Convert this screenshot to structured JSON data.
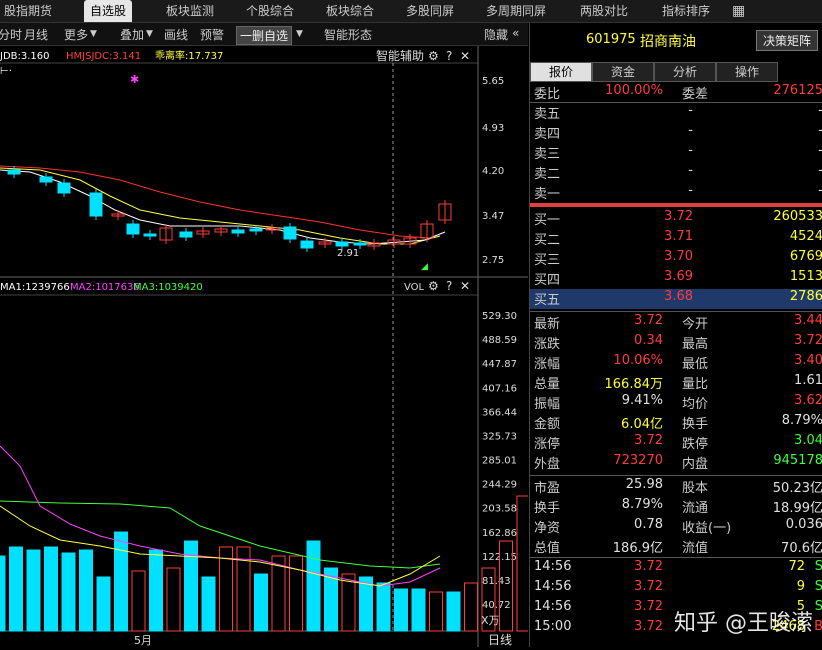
{
  "topbar": {
    "tabs": [
      {
        "label": "股指期货",
        "active": false
      },
      {
        "label": "自选股",
        "active": true
      },
      {
        "label": "板块监测",
        "active": false
      },
      {
        "label": "个股综合",
        "active": false
      },
      {
        "label": "板块综合",
        "active": false
      },
      {
        "label": "多股同屏",
        "active": false
      },
      {
        "label": "多周期同屏",
        "active": false
      },
      {
        "label": "两股对比",
        "active": false
      },
      {
        "label": "指标排序",
        "active": false
      }
    ]
  },
  "toolbar": {
    "items": [
      "分时",
      "月线",
      "更多",
      "叠加",
      "画线",
      "预警",
      "一删自选",
      "智能形态"
    ],
    "hide_label": "隐藏",
    "hide_chevron": "«"
  },
  "kline_panel": {
    "indicators": [
      {
        "text": "JDB:3.160",
        "color": "#ffffff"
      },
      {
        "text": "HMJSJDC:3.141",
        "color": "#ff4040"
      },
      {
        "text": "乖离率:17.737",
        "color": "#ffff40"
      }
    ],
    "assist_label": "智能辅助",
    "y_labels": [
      "5.65",
      "4.93",
      "4.20",
      "3.47",
      "2.75"
    ],
    "low_marker": "2.91"
  },
  "volume_panel": {
    "indicators": [
      {
        "text": "MA1:1239766",
        "color": "#ffffff"
      },
      {
        "text": "MA2:1017636",
        "color": "#ff40ff"
      },
      {
        "text": "MA3:1039420",
        "color": "#40ff40"
      }
    ],
    "vol_label": "VOL",
    "y_labels": [
      "529.30",
      "488.59",
      "447.87",
      "407.16",
      "366.44",
      "325.73",
      "285.01",
      "244.29",
      "203.58",
      "162.86",
      "122.15",
      "81.43",
      "40.72"
    ],
    "unit": "X万",
    "x_label": "5月",
    "period": "日线",
    "volumes": [
      0.25,
      0.28,
      0.27,
      0.28,
      0.26,
      0.27,
      0.18,
      0.33,
      0.2,
      0.27,
      0.21,
      0.3,
      0.18,
      0.28,
      0.28,
      0.19,
      0.25,
      0.25,
      0.3,
      0.21,
      0.19,
      0.18,
      0.16,
      0.14,
      0.14,
      0.13,
      0.13,
      0.16,
      0.21,
      0.3,
      0.45,
      0.38
    ],
    "vol_colors": [
      "c",
      "c",
      "c",
      "c",
      "c",
      "c",
      "c",
      "c",
      "r",
      "c",
      "r",
      "c",
      "c",
      "r",
      "r",
      "c",
      "r",
      "r",
      "c",
      "c",
      "r",
      "c",
      "c",
      "c",
      "c",
      "r",
      "c",
      "r",
      "r",
      "r",
      "r",
      "r"
    ]
  },
  "stock": {
    "code": "601975",
    "name": "招商南油",
    "decision_button": "决策矩阵"
  },
  "panel_tabs": [
    {
      "label": "报价",
      "active": true
    },
    {
      "label": "资金",
      "active": false
    },
    {
      "label": "分析",
      "active": false
    },
    {
      "label": "操作",
      "active": false
    }
  ],
  "weibi": {
    "label": "委比",
    "value": "100.00%",
    "label2": "委差",
    "value2": "276125"
  },
  "asks": [
    {
      "label": "卖五",
      "price": "-",
      "vol": "-"
    },
    {
      "label": "卖四",
      "price": "-",
      "vol": "-"
    },
    {
      "label": "卖三",
      "price": "-",
      "vol": "-"
    },
    {
      "label": "卖二",
      "price": "-",
      "vol": "-"
    },
    {
      "label": "卖一",
      "price": "-",
      "vol": "-"
    }
  ],
  "bids": [
    {
      "label": "买一",
      "price": "3.72",
      "vol": "260533"
    },
    {
      "label": "买二",
      "price": "3.71",
      "vol": "4524"
    },
    {
      "label": "买三",
      "price": "3.70",
      "vol": "6769"
    },
    {
      "label": "买四",
      "price": "3.69",
      "vol": "1513"
    },
    {
      "label": "买五",
      "price": "3.68",
      "vol": "2786"
    }
  ],
  "stats": [
    {
      "l1": "最新",
      "v1": "3.72",
      "c1": "red",
      "l2": "今开",
      "v2": "3.44",
      "c2": "red"
    },
    {
      "l1": "涨跌",
      "v1": "0.34",
      "c1": "red",
      "l2": "最高",
      "v2": "3.72",
      "c2": "red"
    },
    {
      "l1": "涨幅",
      "v1": "10.06%",
      "c1": "red",
      "l2": "最低",
      "v2": "3.40",
      "c2": "red"
    },
    {
      "l1": "总量",
      "v1": "166.84万",
      "c1": "yellow",
      "l2": "量比",
      "v2": "1.61",
      "c2": "white"
    },
    {
      "l1": "振幅",
      "v1": "9.41%",
      "c1": "white",
      "l2": "均价",
      "v2": "3.62",
      "c2": "red"
    },
    {
      "l1": "金额",
      "v1": "6.04亿",
      "c1": "yellow",
      "l2": "换手",
      "v2": "8.79%",
      "c2": "white"
    },
    {
      "l1": "涨停",
      "v1": "3.72",
      "c1": "red",
      "l2": "跌停",
      "v2": "3.04",
      "c2": "green"
    },
    {
      "l1": "外盘",
      "v1": "723270",
      "c1": "red",
      "l2": "内盘",
      "v2": "945178",
      "c2": "green"
    }
  ],
  "fundamentals": [
    {
      "l1": "市盈",
      "v1": "25.98",
      "l2": "股本",
      "v2": "50.23亿"
    },
    {
      "l1": "换手",
      "v1": "8.79%",
      "l2": "流通",
      "v2": "18.99亿"
    },
    {
      "l1": "净资",
      "v1": "0.78",
      "l2": "收益(一)",
      "v2": "0.036"
    },
    {
      "l1": "总值",
      "v1": "186.9亿",
      "l2": "流值",
      "v2": "70.6亿"
    }
  ],
  "ticks": [
    {
      "time": "14:56",
      "price": "3.72",
      "vol": "72",
      "side": "S"
    },
    {
      "time": "14:56",
      "price": "3.72",
      "vol": "9",
      "side": "S"
    },
    {
      "time": "14:56",
      "price": "3.72",
      "vol": "5",
      "side": "S"
    },
    {
      "time": "15:00",
      "price": "3.72",
      "vol": "2468",
      "side": "B"
    }
  ],
  "watermark": "知乎 @王晙潆",
  "colors": {
    "up": "#ff3c3c",
    "down": "#00e0ff",
    "ma1": "#ffffff",
    "ma2": "#ffff40",
    "ma3": "#ff3030"
  }
}
